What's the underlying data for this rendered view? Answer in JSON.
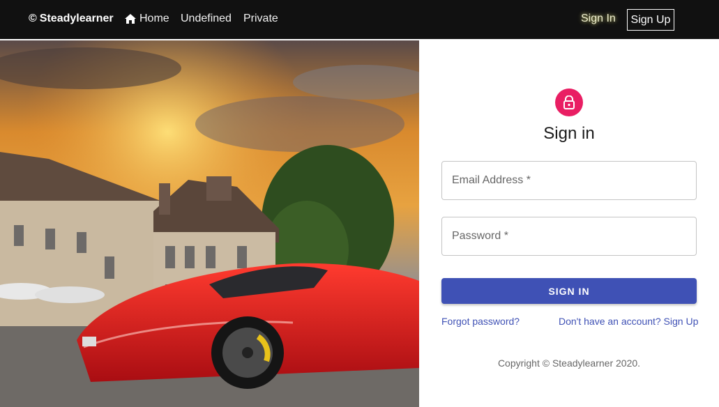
{
  "navbar": {
    "brand_symbol": "©",
    "brand_name": "Steadylearner",
    "links": [
      {
        "label": "Home",
        "icon": "home-icon"
      },
      {
        "label": "Undefined"
      },
      {
        "label": "Private"
      }
    ],
    "sign_in_label": "Sign In",
    "sign_up_label": "Sign Up"
  },
  "form": {
    "lock_icon": "lock-icon",
    "title": "Sign in",
    "email_placeholder": "Email Address *",
    "password_placeholder": "Password *",
    "submit_label": "SIGN IN",
    "forgot_label": "Forgot password?",
    "signup_label": "Don't have an account? Sign Up",
    "copyright": "Copyright © Steadylearner 2020."
  },
  "colors": {
    "navbar_bg": "#111111",
    "accent": "#3f51b5",
    "avatar": "#e91e63"
  }
}
